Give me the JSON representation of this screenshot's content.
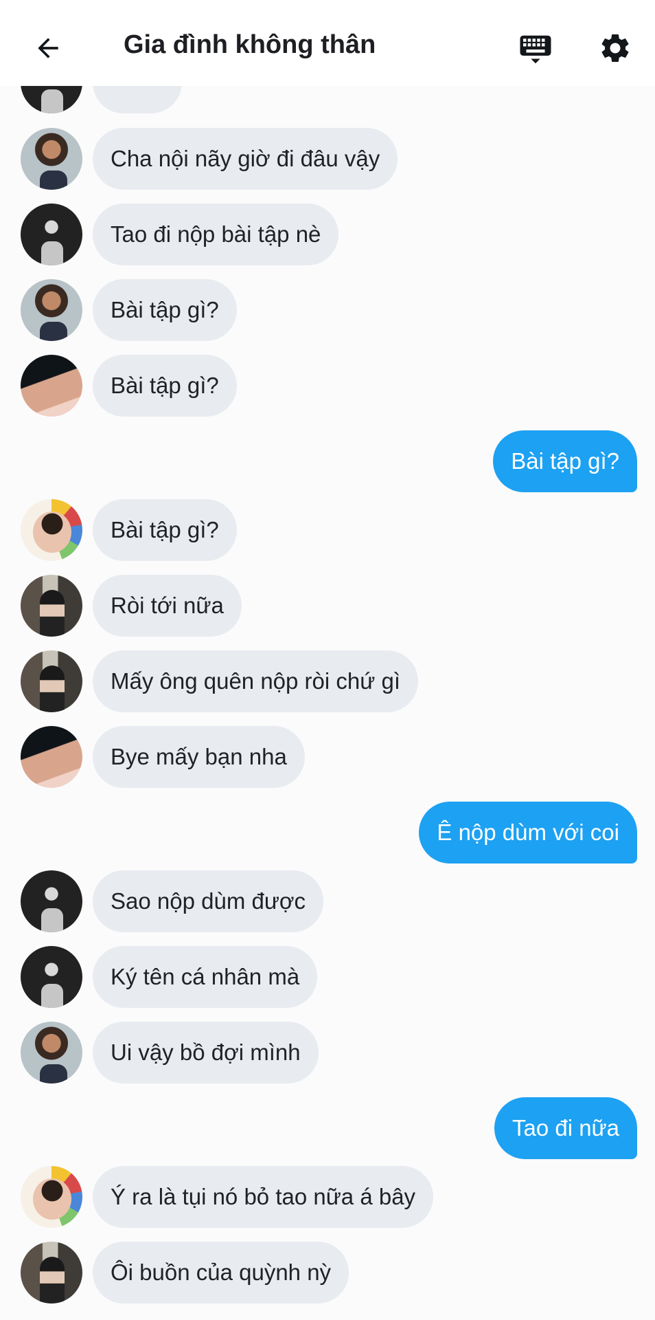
{
  "header": {
    "title": "Gia đình không thân",
    "back_icon": "arrow-left-icon",
    "keyboard_icon": "keyboard-icon",
    "settings_icon": "gear-icon"
  },
  "messages": [
    {
      "side": "in",
      "avatar": "avatar-a",
      "text": "Cha nội nãy giờ đi đâu vậy"
    },
    {
      "side": "in",
      "avatar": "avatar-b",
      "text": "Tao đi nộp bài tập nè"
    },
    {
      "side": "in",
      "avatar": "avatar-a",
      "text": "Bài tập gì?"
    },
    {
      "side": "in",
      "avatar": "avatar-c",
      "text": "Bài tập gì?"
    },
    {
      "side": "out",
      "text": "Bài tập gì?"
    },
    {
      "side": "in",
      "avatar": "avatar-d",
      "text": "Bài tập gì?"
    },
    {
      "side": "in",
      "avatar": "avatar-e",
      "text": "Ròi tới nữa"
    },
    {
      "side": "in",
      "avatar": "avatar-e",
      "text": "Mấy ông quên nộp ròi chứ gì"
    },
    {
      "side": "in",
      "avatar": "avatar-c",
      "text": "Bye mấy bạn nha"
    },
    {
      "side": "out",
      "text": "Ê nộp dùm với coi"
    },
    {
      "side": "in",
      "avatar": "avatar-b",
      "text": "Sao nộp dùm được"
    },
    {
      "side": "in",
      "avatar": "avatar-b",
      "text": "Ký tên cá nhân mà"
    },
    {
      "side": "in",
      "avatar": "avatar-a",
      "text": "Ui vậy bồ đợi mình"
    },
    {
      "side": "out",
      "text": "Tao đi nữa"
    },
    {
      "side": "in",
      "avatar": "avatar-d",
      "text": "Ý ra là tụi nó bỏ tao nữa á bây"
    },
    {
      "side": "in",
      "avatar": "avatar-e",
      "text": "Ôi buồn của quỳnh nỳ"
    }
  ],
  "colors": {
    "outgoing_bubble": "#1da1f2",
    "incoming_bubble": "#e8ebef",
    "text_dark": "#202226"
  }
}
